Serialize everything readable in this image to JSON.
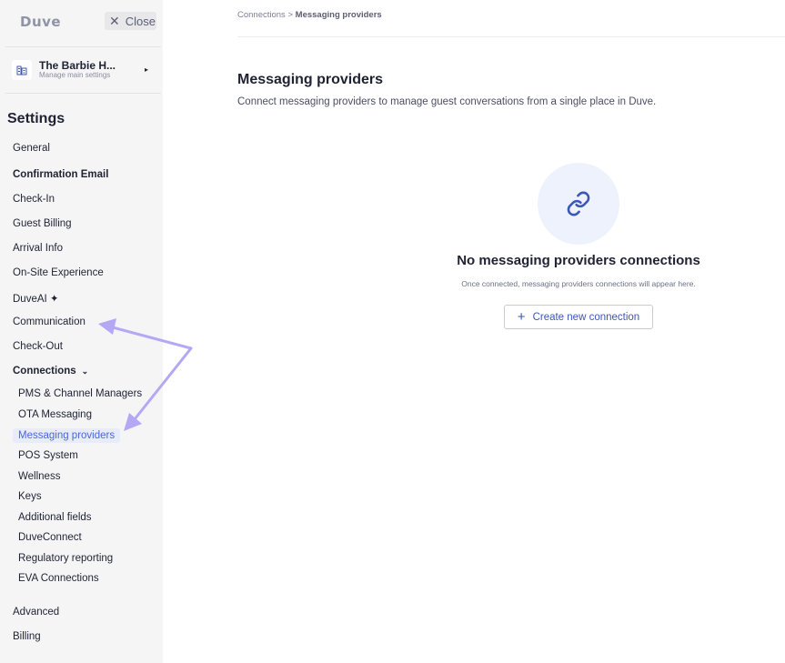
{
  "sidebar": {
    "logo": "Duve",
    "close_label": "Close",
    "property": {
      "name": "The Barbie H...",
      "subtitle": "Manage main settings"
    },
    "settings_title": "Settings",
    "items": [
      {
        "label": "General",
        "bold": false
      },
      {
        "label": "Confirmation Email",
        "bold": true
      },
      {
        "label": "Check-In",
        "bold": false
      },
      {
        "label": "Guest Billing",
        "bold": false
      },
      {
        "label": "Arrival Info",
        "bold": false
      },
      {
        "label": "On-Site Experience",
        "bold": false
      },
      {
        "label": "DuveAI ✦",
        "bold": false
      },
      {
        "label": "Communication",
        "bold": false
      },
      {
        "label": "Check-Out",
        "bold": false
      },
      {
        "label": "Connections",
        "bold": true
      }
    ],
    "connections_sub": [
      "PMS & Channel Managers",
      "OTA Messaging",
      "Messaging providers",
      "POS System",
      "Wellness",
      "Keys",
      "Additional fields",
      "DuveConnect",
      "Regulatory reporting",
      "EVA Connections"
    ],
    "bottom_items": [
      "Advanced",
      "Billing"
    ]
  },
  "breadcrumb": {
    "parent": "Connections",
    "separator": ">",
    "current": "Messaging providers"
  },
  "main": {
    "title": "Messaging providers",
    "description": "Connect messaging providers to manage guest conversations from a single place in Duve."
  },
  "empty_state": {
    "icon": "link-icon",
    "title": "No messaging providers connections",
    "subtitle": "Once connected, messaging providers connections will appear here.",
    "button_label": "Create new connection"
  },
  "colors": {
    "accent": "#4a67d6",
    "annotation_arrow": "#b4a8f5",
    "sidebar_bg": "#f5f5f6"
  }
}
